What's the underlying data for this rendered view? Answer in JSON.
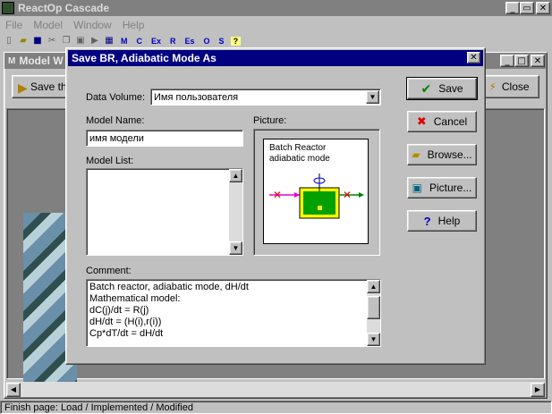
{
  "app": {
    "title": "ReactOp Cascade"
  },
  "menu": [
    "File",
    "Model",
    "Window",
    "Help"
  ],
  "toolbar": {
    "text_buttons": [
      "M",
      "C",
      "Ex",
      "R",
      "Es",
      "O",
      "S"
    ],
    "help": "?"
  },
  "child": {
    "title": "Model W",
    "save_label": "Save the",
    "close_label": "Close"
  },
  "status": "Finish page:  Load / Implemented / Modified",
  "dialog": {
    "title": "Save BR, Adiabatic Mode As",
    "volume_label": "Data Volume:",
    "volume_value": "Имя пользователя",
    "name_label": "Model Name:",
    "name_value": "имя модели",
    "list_label": "Model List:",
    "picture_label": "Picture:",
    "picture_title": "Batch Reactor\nadiabatic mode",
    "comment_label": "Comment:",
    "comment_text": "Batch reactor, adiabatic mode, dH/dt\nMathematical model:\ndC(j)/dt = R(j)\ndH/dt = (H(i),r(i))\nCp*dT/dt = dH/dt",
    "buttons": {
      "save": "Save",
      "cancel": "Cancel",
      "browse": "Browse...",
      "picture": "Picture...",
      "help": "Help"
    }
  },
  "colors": {
    "titlebar_active": "#000080",
    "titlebar_inactive": "#808080",
    "face": "#c0c0c0"
  }
}
